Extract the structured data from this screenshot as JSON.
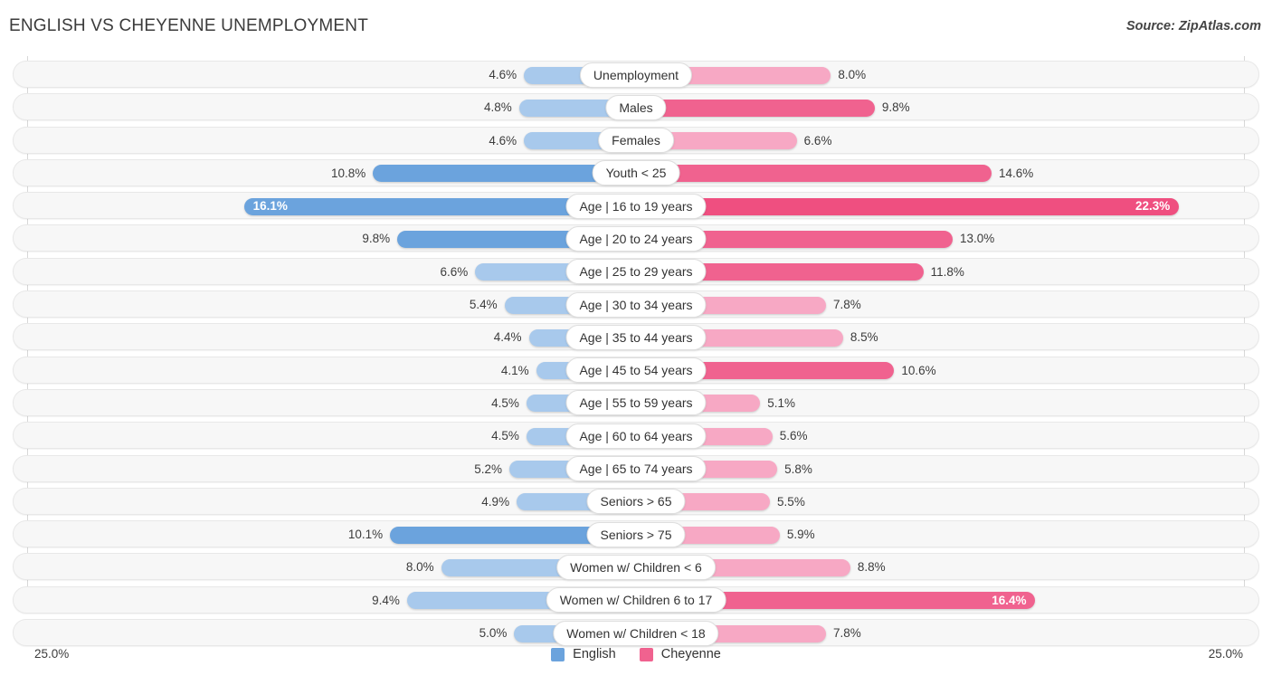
{
  "header": {
    "title": "ENGLISH VS CHEYENNE UNEMPLOYMENT",
    "source": "Source: ZipAtlas.com"
  },
  "axis": {
    "left_label": "25.0%",
    "right_label": "25.0%",
    "max": 25.0
  },
  "legend": {
    "items": [
      {
        "label": "English",
        "color": "#6ba3dd"
      },
      {
        "label": "Cheyenne",
        "color": "#f0628f"
      }
    ]
  },
  "colors": {
    "english_strong": "#6ba3dd",
    "english_light": "#a8c9ec",
    "cheyenne_strong": "#f0628f",
    "cheyenne_light": "#f7a8c4",
    "track": "#f7f7f7",
    "text": "#3c3c3c"
  },
  "chart_data": {
    "type": "bar",
    "title": "ENGLISH VS CHEYENNE UNEMPLOYMENT",
    "subtitle": "Source: ZipAtlas.com",
    "orientation": "horizontal-diverging",
    "xlabel": "",
    "ylabel": "",
    "xlim": [
      25.0,
      25.0
    ],
    "grid": false,
    "legend_position": "bottom-center",
    "categories": [
      "Unemployment",
      "Males",
      "Females",
      "Youth < 25",
      "Age | 16 to 19 years",
      "Age | 20 to 24 years",
      "Age | 25 to 29 years",
      "Age | 30 to 34 years",
      "Age | 35 to 44 years",
      "Age | 45 to 54 years",
      "Age | 55 to 59 years",
      "Age | 60 to 64 years",
      "Age | 65 to 74 years",
      "Seniors > 65",
      "Seniors > 75",
      "Women w/ Children < 6",
      "Women w/ Children 6 to 17",
      "Women w/ Children < 18"
    ],
    "series": [
      {
        "name": "English",
        "values": [
          4.6,
          4.8,
          4.6,
          10.8,
          16.1,
          9.8,
          6.6,
          5.4,
          4.4,
          4.1,
          4.5,
          4.5,
          5.2,
          4.9,
          10.1,
          8.0,
          9.4,
          5.0
        ],
        "labels": [
          "4.6%",
          "4.8%",
          "4.6%",
          "10.8%",
          "16.1%",
          "9.8%",
          "6.6%",
          "5.4%",
          "4.4%",
          "4.1%",
          "4.5%",
          "4.5%",
          "5.2%",
          "4.9%",
          "10.1%",
          "8.0%",
          "9.4%",
          "5.0%"
        ]
      },
      {
        "name": "Cheyenne",
        "values": [
          8.0,
          9.8,
          6.6,
          14.6,
          22.3,
          13.0,
          11.8,
          7.8,
          8.5,
          10.6,
          5.1,
          5.6,
          5.8,
          5.5,
          5.9,
          8.8,
          16.4,
          7.8
        ],
        "labels": [
          "8.0%",
          "9.8%",
          "6.6%",
          "14.6%",
          "22.3%",
          "13.0%",
          "11.8%",
          "7.8%",
          "8.5%",
          "10.6%",
          "5.1%",
          "5.6%",
          "5.8%",
          "5.5%",
          "5.9%",
          "8.8%",
          "16.4%",
          "7.8%"
        ]
      }
    ]
  }
}
